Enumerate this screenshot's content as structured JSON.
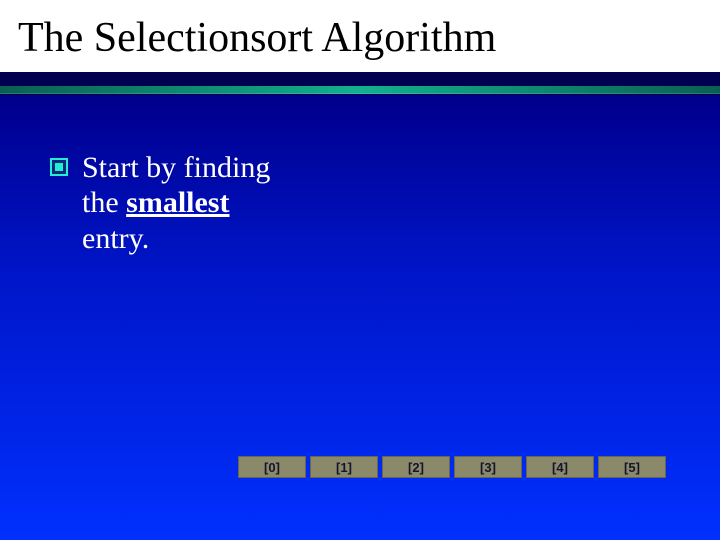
{
  "title": "The Selectionsort Algorithm",
  "bullet": {
    "pre": "Start by finding the ",
    "emph": "smallest",
    "post": " entry."
  },
  "indices": [
    "[0]",
    "[1]",
    "[2]",
    "[3]",
    "[4]",
    "[5]"
  ]
}
